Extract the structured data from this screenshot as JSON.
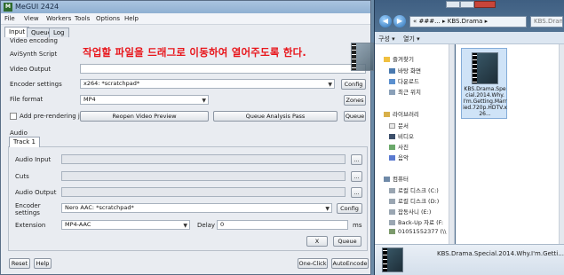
{
  "megui": {
    "title": "MeGUI 2424",
    "menu": [
      "File",
      "View",
      "Workers",
      "Tools",
      "Options",
      "Help"
    ],
    "tabs": [
      "Input",
      "Queue",
      "Log"
    ],
    "video_section": "Video encoding",
    "avisynth_label": "AviSynth Script",
    "video_output_label": "Video Output",
    "encoder_settings_label": "Encoder settings",
    "encoder_value": "x264: *scratchpad*",
    "config_label": "Config",
    "file_format_label": "File format",
    "file_format_value": "MP4",
    "zones_label": "Zones",
    "add_prerendering_label": "Add pre-rendering job",
    "reopen_preview_label": "Reopen Video Preview",
    "queue_analysis_label": "Queue Analysis Pass",
    "queue_label": "Queue",
    "overlay_instruction": "작업할 파일을 드래그로 이동하여 열어주도록 한다.",
    "audio_section": "Audio",
    "track_tab": "Track 1",
    "audio_input_label": "Audio Input",
    "cuts_label": "Cuts",
    "audio_output_label": "Audio Output",
    "audio_encoder_label": "Encoder settings",
    "audio_encoder_value": "Nero AAC: *scratchpad*",
    "audio_config_label": "Config",
    "extension_label": "Extension",
    "extension_value": "MP4-AAC",
    "delay_label": "Delay",
    "delay_value": "0",
    "ms_label": "ms",
    "x_label": "X",
    "audio_queue_label": "Queue",
    "browse_label": "...",
    "reset_label": "Reset",
    "help_label": "Help",
    "oneclick_label": "One-Click",
    "autoencode_label": "AutoEncode"
  },
  "explorer": {
    "address": "«  ###...  ▸  KBS.Drama  ▸",
    "search_placeholder": "KBS.Drama",
    "organize_label": "구성 ▾",
    "open_label": "열기 ▾",
    "nav_items": [
      {
        "label": "즐겨찾기",
        "icon": "star-icon"
      },
      {
        "label": "바탕 화면",
        "icon": "desktop-icon"
      },
      {
        "label": "다운로드",
        "icon": "download-icon"
      },
      {
        "label": "최근 위치",
        "icon": "recent-icon"
      },
      {
        "label": "라이브러리",
        "icon": "library-icon"
      },
      {
        "label": "문서",
        "icon": "document-icon"
      },
      {
        "label": "비디오",
        "icon": "video-icon"
      },
      {
        "label": "사진",
        "icon": "picture-icon"
      },
      {
        "label": "음악",
        "icon": "music-icon"
      },
      {
        "label": "컴퓨터",
        "icon": "computer-icon"
      },
      {
        "label": "로컬 디스크 (C:)",
        "icon": "drive-icon"
      },
      {
        "label": "로컬 디스크 (D:)",
        "icon": "drive-icon"
      },
      {
        "label": "잡동사니 (E:)",
        "icon": "drive-icon"
      },
      {
        "label": "Back-Up 자료 (F:",
        "icon": "drive-icon"
      },
      {
        "label": "01051552377 (\\\\",
        "icon": "network-drive-icon"
      }
    ],
    "file_name": "KBS.Drama.Special.2014.Why.I'm.Getting.Married.720p.HDTV.x26...",
    "details_file_name": "KBS.Drama.Special.2014.Why.I'm.Getti..."
  },
  "colors": {
    "overlay_text": "#e8151b",
    "explorer_chrome": "#4d6a89"
  }
}
